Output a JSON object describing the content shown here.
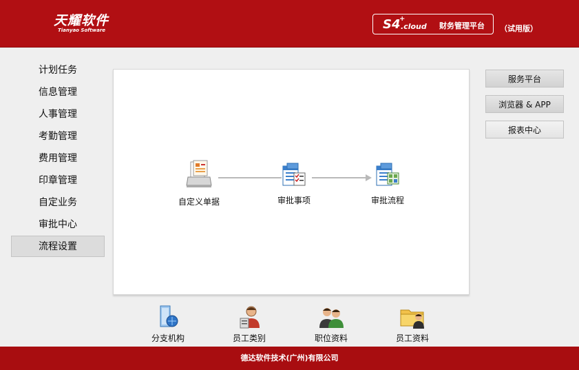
{
  "header": {
    "logo_cn": "天耀软件",
    "logo_en": "Tianyao Software",
    "product_s4": "S4",
    "product_plus": "+",
    "product_cloud": ".cloud",
    "product_platform": "财务管理平台",
    "trial": "（试用版）"
  },
  "sidebar": {
    "items": [
      {
        "label": "计划任务"
      },
      {
        "label": "信息管理"
      },
      {
        "label": "人事管理"
      },
      {
        "label": "考勤管理"
      },
      {
        "label": "费用管理"
      },
      {
        "label": "印章管理"
      },
      {
        "label": "自定业务"
      },
      {
        "label": "审批中心"
      },
      {
        "label": "流程设置",
        "active": true
      }
    ]
  },
  "flow": {
    "nodes": [
      {
        "label": "自定义单据",
        "icon": "custom-form-icon"
      },
      {
        "label": "审批事项",
        "icon": "approval-items-icon"
      },
      {
        "label": "审批流程",
        "icon": "approval-flow-icon"
      }
    ]
  },
  "right_buttons": [
    {
      "label": "服务平台"
    },
    {
      "label": "浏览器 & APP"
    },
    {
      "label": "报表中心"
    }
  ],
  "bottom_items": [
    {
      "label": "分支机构",
      "icon": "branch-org-icon"
    },
    {
      "label": "员工类别",
      "icon": "employee-category-icon"
    },
    {
      "label": "职位资料",
      "icon": "position-info-icon"
    },
    {
      "label": "员工资料",
      "icon": "employee-info-icon"
    }
  ],
  "footer": {
    "company": "德达软件技术(广州)有限公司"
  },
  "colors": {
    "brand_red": "#b10f13",
    "footer_red": "#a80d10",
    "background": "#efefef"
  }
}
